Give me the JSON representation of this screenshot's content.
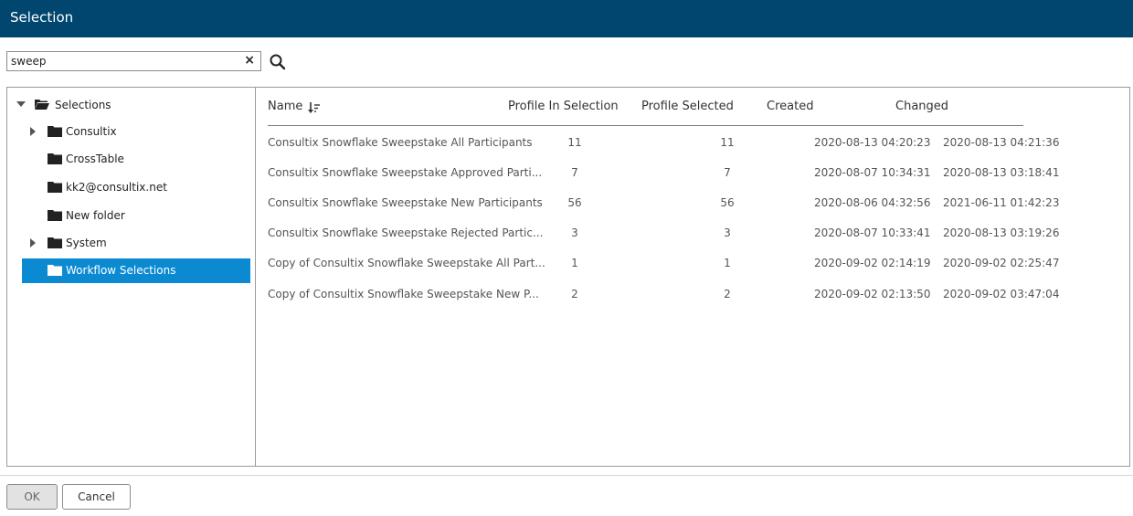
{
  "dialog": {
    "title": "Selection"
  },
  "search": {
    "value": "sweep",
    "clear_label": "×"
  },
  "tree": {
    "root": {
      "label": "Selections",
      "expanded": true
    },
    "items": [
      {
        "label": "Consultix",
        "has_children": true
      },
      {
        "label": "CrossTable",
        "has_children": false
      },
      {
        "label": "kk2@consultix.net",
        "has_children": false
      },
      {
        "label": "New folder",
        "has_children": false
      },
      {
        "label": "System",
        "has_children": true
      },
      {
        "label": "Workflow Selections",
        "has_children": false,
        "selected": true
      }
    ]
  },
  "table": {
    "columns": [
      "Name",
      "Profile In Selection",
      "Profile Selected",
      "Created",
      "Changed"
    ],
    "sort_icon": "sort-descending-icon",
    "rows": [
      {
        "name": "Consultix Snowflake Sweepstake All Participants",
        "in_selection": "11",
        "selected": "11",
        "created": "2020-08-13 04:20:23",
        "changed": "2020-08-13 04:21:36"
      },
      {
        "name": "Consultix Snowflake Sweepstake Approved Parti...",
        "in_selection": "7",
        "selected": "7",
        "created": "2020-08-07 10:34:31",
        "changed": "2020-08-13 03:18:41"
      },
      {
        "name": "Consultix Snowflake Sweepstake New Participants",
        "in_selection": "56",
        "selected": "56",
        "created": "2020-08-06 04:32:56",
        "changed": "2021-06-11 01:42:23"
      },
      {
        "name": "Consultix Snowflake Sweepstake Rejected Partic...",
        "in_selection": "3",
        "selected": "3",
        "created": "2020-08-07 10:33:41",
        "changed": "2020-08-13 03:19:26"
      },
      {
        "name": "Copy of Consultix Snowflake Sweepstake All Part...",
        "in_selection": "1",
        "selected": "1",
        "created": "2020-09-02 02:14:19",
        "changed": "2020-09-02 02:25:47"
      },
      {
        "name": "Copy of Consultix Snowflake Sweepstake New P...",
        "in_selection": "2",
        "selected": "2",
        "created": "2020-09-02 02:13:50",
        "changed": "2020-09-02 03:47:04"
      }
    ]
  },
  "buttons": {
    "ok": "OK",
    "cancel": "Cancel"
  },
  "colors": {
    "titlebar": "#00466e",
    "selected_row": "#0b8ad2"
  }
}
